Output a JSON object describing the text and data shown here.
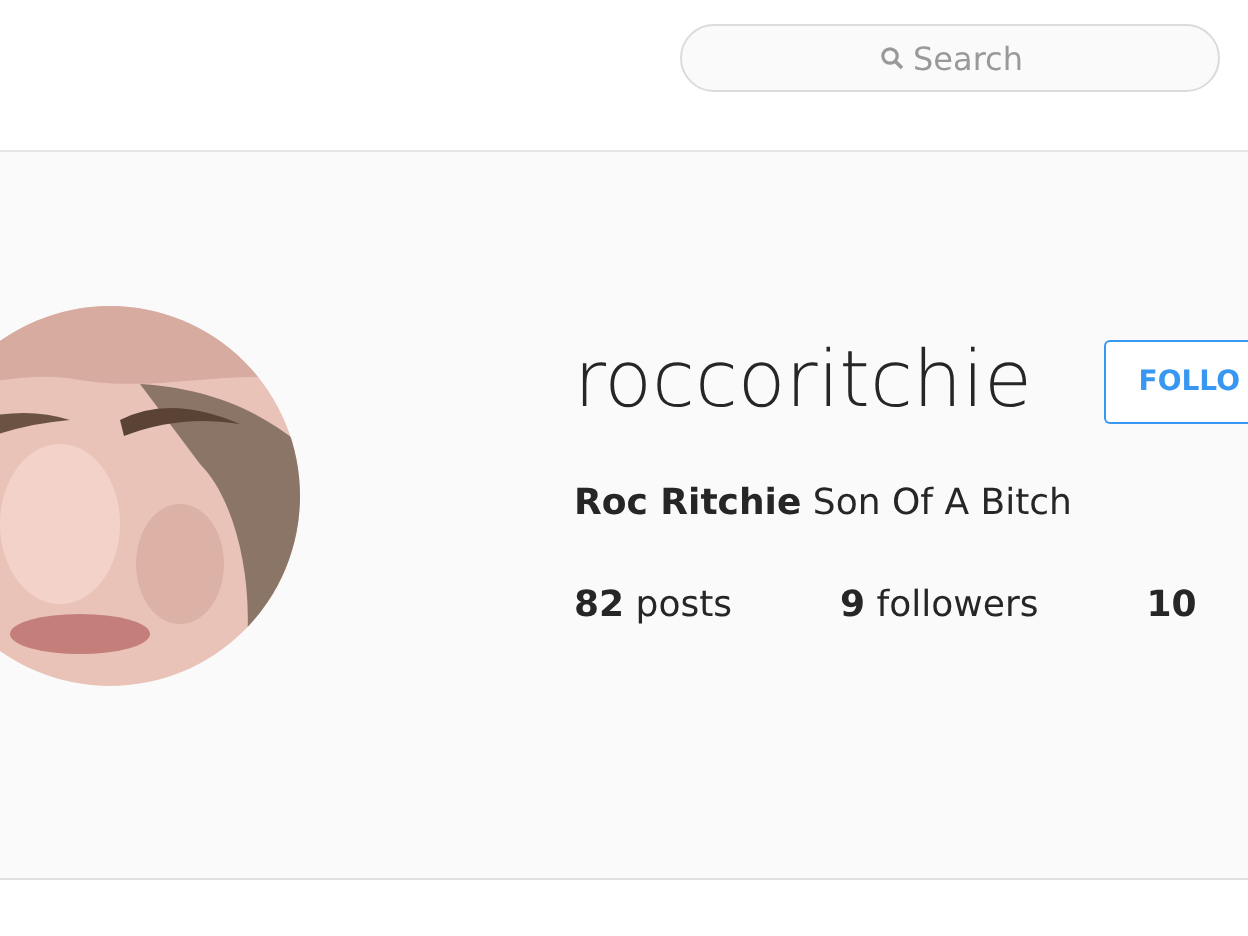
{
  "search": {
    "placeholder": "Search"
  },
  "profile": {
    "username": "roccoritchie",
    "follow_button": "FOLLO",
    "bio": "**Roc Ritchie** Son Of A Bitch",
    "stats": [
      {
        "count": "82",
        "label": "posts"
      },
      {
        "count": "9",
        "label": "followers"
      },
      {
        "count": "10"
      }
    ]
  }
}
